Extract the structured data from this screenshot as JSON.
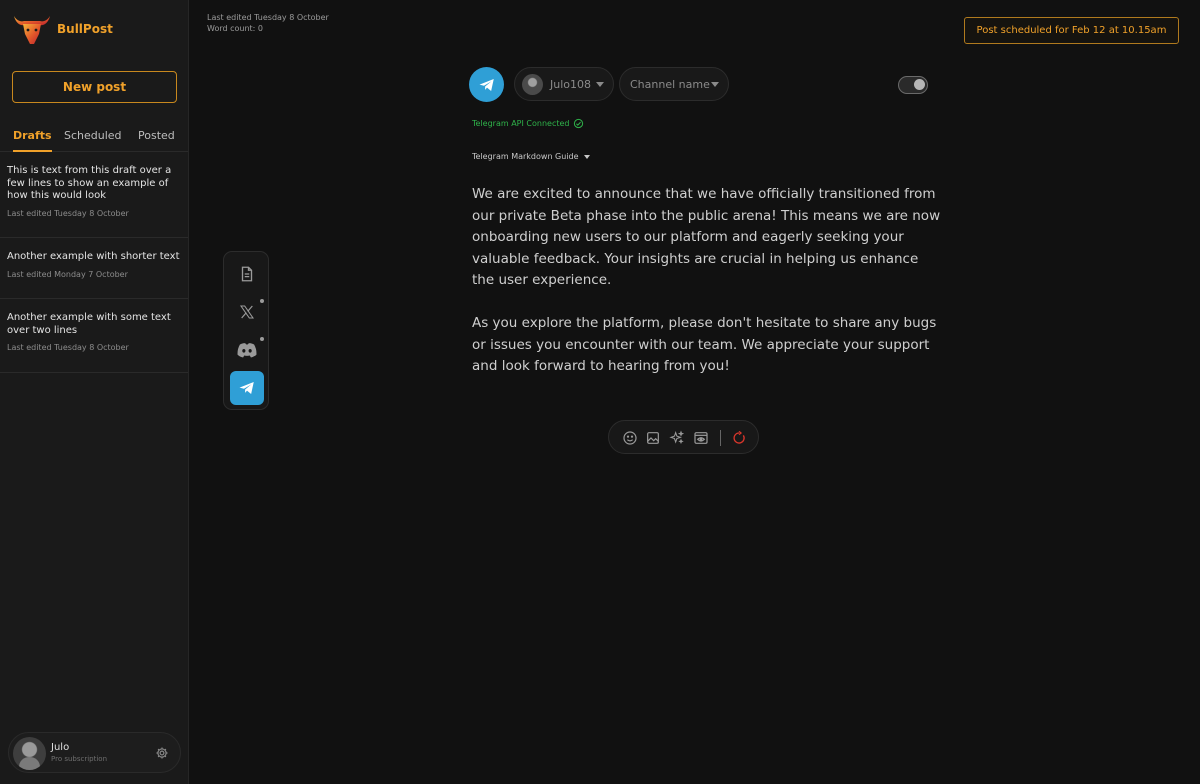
{
  "brand": {
    "name": "BullPost",
    "icon": "bull-logo-icon"
  },
  "sidebar": {
    "new_post_label": "New post",
    "tabs": [
      {
        "label": "Drafts",
        "active": true
      },
      {
        "label": "Scheduled",
        "active": false
      },
      {
        "label": "Posted",
        "active": false
      }
    ],
    "drafts": [
      {
        "title": "This is text from this draft over a few lines to show an example of how this would look",
        "date": "Last edited Tuesday 8 October"
      },
      {
        "title": "Another example with shorter text",
        "date": "Last edited Monday 7 October"
      },
      {
        "title": "Another example with some text over two lines",
        "date": "Last edited Tuesday 8 October"
      }
    ],
    "user": {
      "name": "Julo",
      "plan": "Pro subscription"
    }
  },
  "topbar": {
    "last_edited": "Last edited Tuesday 8 October",
    "word_count": "Word count: 0",
    "scheduled_label": "Post scheduled for Feb 12 at 10.15am"
  },
  "composer": {
    "account_name": "Julo108",
    "channel_placeholder": "Channel name",
    "api_status": "Telegram API Connected",
    "markdown_guide": "Telegram Markdown Guide",
    "toggle_on": true,
    "paragraphs": [
      "We are excited to announce that we have officially transitioned from our private Beta phase into the public arena! This means we are now onboarding new users to our platform and eagerly seeking your valuable feedback. Your insights are crucial in helping us enhance the user experience.",
      "As you explore the platform, please don't hesitate to share any bugs or issues you encounter with our team. We appreciate your support and look forward to hearing from you!"
    ]
  },
  "platform_rail": [
    {
      "icon": "document-icon",
      "active": false,
      "dot": false
    },
    {
      "icon": "x-logo-icon",
      "active": false,
      "dot": true
    },
    {
      "icon": "discord-icon",
      "active": false,
      "dot": true
    },
    {
      "icon": "telegram-icon",
      "active": true,
      "dot": false
    }
  ],
  "toolbar_icons": [
    "emoji-icon",
    "image-icon",
    "sparkle-icon",
    "preview-icon",
    "reset-icon"
  ],
  "colors": {
    "accent": "#f0a12a",
    "telegram": "#2f9fd6",
    "success": "#2fb24a",
    "danger": "#d9362b",
    "background": "#111111",
    "sidebar": "#1a1a1a"
  }
}
